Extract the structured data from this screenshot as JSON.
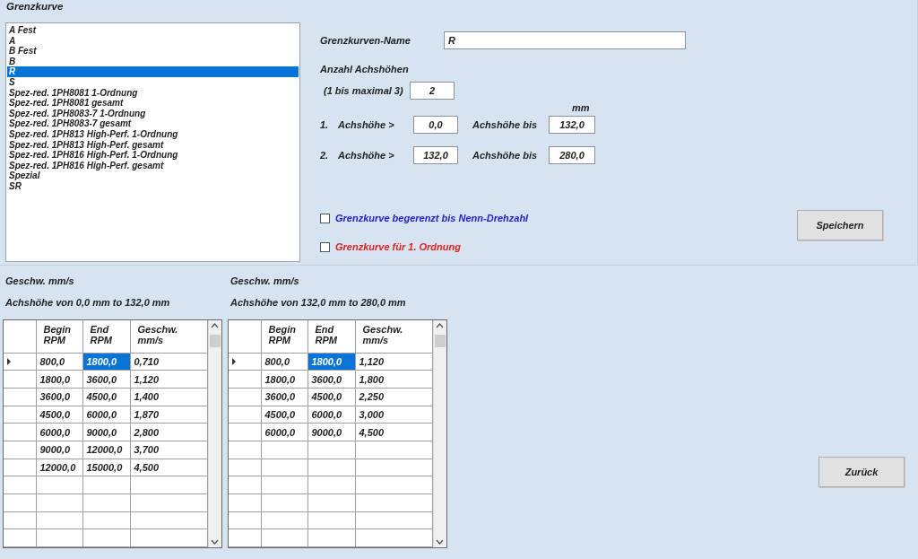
{
  "group_title": "Grenzkurve",
  "curve_list": [
    {
      "label": "A Fest",
      "selected": false
    },
    {
      "label": "A",
      "selected": false
    },
    {
      "label": "B Fest",
      "selected": false
    },
    {
      "label": "B",
      "selected": false
    },
    {
      "label": "R",
      "selected": true
    },
    {
      "label": "S",
      "selected": false
    },
    {
      "label": "Spez-red. 1PH8081 1-Ordnung",
      "selected": false
    },
    {
      "label": "Spez-red. 1PH8081 gesamt",
      "selected": false
    },
    {
      "label": "Spez-red. 1PH8083-7 1-Ordnung",
      "selected": false
    },
    {
      "label": "Spez-red. 1PH8083-7 gesamt",
      "selected": false
    },
    {
      "label": "Spez-red. 1PH813 High-Perf. 1-Ordnung",
      "selected": false
    },
    {
      "label": "Spez-red. 1PH813 High-Perf. gesamt",
      "selected": false
    },
    {
      "label": "Spez-red. 1PH816 High-Perf. 1-Ordnung",
      "selected": false
    },
    {
      "label": "Spez-red. 1PH816 High-Perf. gesamt",
      "selected": false
    },
    {
      "label": "Spezial",
      "selected": false
    },
    {
      "label": "SR",
      "selected": false
    }
  ],
  "name_field": {
    "label": "Grenzkurven-Name",
    "value": "R"
  },
  "count": {
    "heading": "Anzahl Achshöhen",
    "label": "(1 bis maximal 3)",
    "value": "2"
  },
  "unit": "mm",
  "ranges": [
    {
      "index": "1.",
      "from_label": "Achshöhe >",
      "from": "0,0",
      "to_label": "Achshöhe bis",
      "to": "132,0"
    },
    {
      "index": "2.",
      "from_label": "Achshöhe >",
      "from": "132,0",
      "to_label": "Achshöhe bis",
      "to": "280,0"
    }
  ],
  "options": [
    {
      "label": "Grenzkurve begerenzt bis Nenn-Drehzahl",
      "checked": false,
      "color": "#2020d0"
    },
    {
      "label": "Grenzkurve für 1. Ordnung",
      "checked": false,
      "color": "#e02020"
    }
  ],
  "save_button": "Speichern",
  "tables": [
    {
      "unit_label": "Geschw. mm/s",
      "range_label": "Achshöhe von 0,0 mm to 132,0 mm",
      "columns": [
        "Begin\nRPM",
        "End\nRPM",
        "Geschw.\nmm/s"
      ],
      "rows": [
        {
          "current": true,
          "cells": [
            {
              "text": "800,0",
              "selected": false
            },
            {
              "text": "1800,0",
              "selected": true
            },
            {
              "text": "0,710",
              "selected": false
            }
          ]
        },
        {
          "current": false,
          "cells": [
            {
              "text": "1800,0",
              "selected": false
            },
            {
              "text": "3600,0",
              "selected": false
            },
            {
              "text": "1,120",
              "selected": false
            }
          ]
        },
        {
          "current": false,
          "cells": [
            {
              "text": "3600,0",
              "selected": false
            },
            {
              "text": "4500,0",
              "selected": false
            },
            {
              "text": "1,400",
              "selected": false
            }
          ]
        },
        {
          "current": false,
          "cells": [
            {
              "text": "4500,0",
              "selected": false
            },
            {
              "text": "6000,0",
              "selected": false
            },
            {
              "text": "1,870",
              "selected": false
            }
          ]
        },
        {
          "current": false,
          "cells": [
            {
              "text": "6000,0",
              "selected": false
            },
            {
              "text": "9000,0",
              "selected": false
            },
            {
              "text": "2,800",
              "selected": false
            }
          ]
        },
        {
          "current": false,
          "cells": [
            {
              "text": "9000,0",
              "selected": false
            },
            {
              "text": "12000,0",
              "selected": false
            },
            {
              "text": "3,700",
              "selected": false
            }
          ]
        },
        {
          "current": false,
          "cells": [
            {
              "text": "12000,0",
              "selected": false
            },
            {
              "text": "15000,0",
              "selected": false
            },
            {
              "text": "4,500",
              "selected": false
            }
          ]
        }
      ]
    },
    {
      "unit_label": "Geschw. mm/s",
      "range_label": "Achshöhe von 132,0 mm to 280,0 mm",
      "columns": [
        "Begin\nRPM",
        "End\nRPM",
        "Geschw.\nmm/s"
      ],
      "rows": [
        {
          "current": true,
          "cells": [
            {
              "text": "800,0",
              "selected": false
            },
            {
              "text": "1800,0",
              "selected": true
            },
            {
              "text": "1,120",
              "selected": false
            }
          ]
        },
        {
          "current": false,
          "cells": [
            {
              "text": "1800,0",
              "selected": false
            },
            {
              "text": "3600,0",
              "selected": false
            },
            {
              "text": "1,800",
              "selected": false
            }
          ]
        },
        {
          "current": false,
          "cells": [
            {
              "text": "3600,0",
              "selected": false
            },
            {
              "text": "4500,0",
              "selected": false
            },
            {
              "text": "2,250",
              "selected": false
            }
          ]
        },
        {
          "current": false,
          "cells": [
            {
              "text": "4500,0",
              "selected": false
            },
            {
              "text": "6000,0",
              "selected": false
            },
            {
              "text": "3,000",
              "selected": false
            }
          ]
        },
        {
          "current": false,
          "cells": [
            {
              "text": "6000,0",
              "selected": false
            },
            {
              "text": "9000,0",
              "selected": false
            },
            {
              "text": "4,500",
              "selected": false
            }
          ]
        }
      ]
    }
  ],
  "back_button": "Zurück"
}
